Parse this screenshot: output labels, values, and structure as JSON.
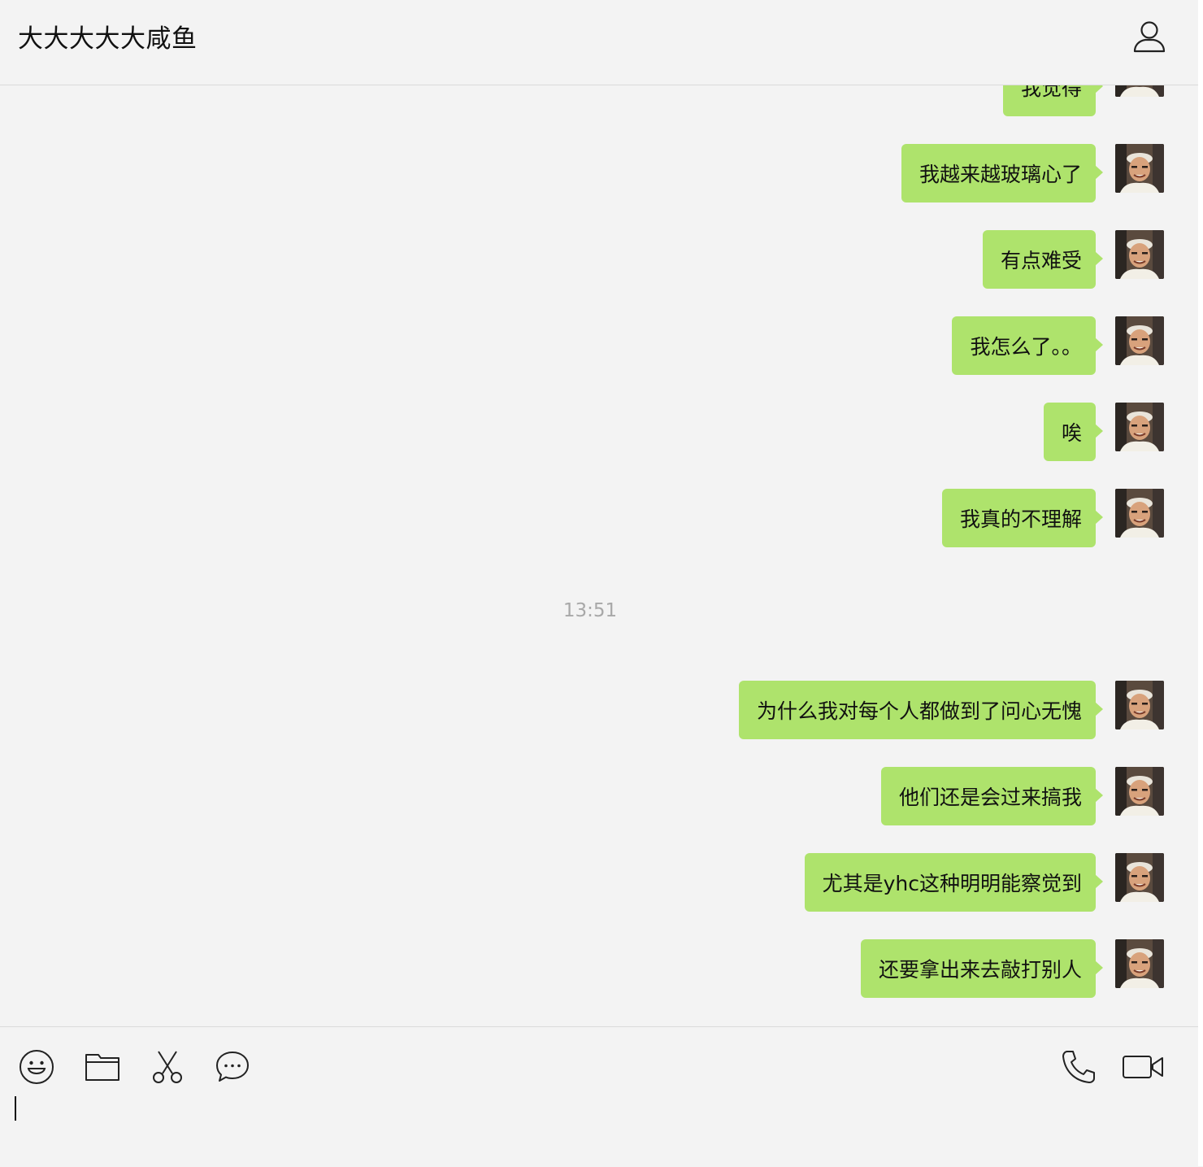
{
  "window": {
    "title": "大大大大大咸鱼"
  },
  "header": {
    "profile_icon": "person-icon"
  },
  "messages": [
    {
      "text": "我觉得",
      "sender": "me"
    },
    {
      "text": "我越来越玻璃心了",
      "sender": "me"
    },
    {
      "text": "有点难受",
      "sender": "me"
    },
    {
      "text": "我怎么了。。",
      "sender": "me"
    },
    {
      "text": "唉",
      "sender": "me"
    },
    {
      "text": "我真的不理解",
      "sender": "me"
    },
    {
      "timestamp": "13:51"
    },
    {
      "text": "为什么我对每个人都做到了问心无愧",
      "sender": "me"
    },
    {
      "text": "他们还是会过来搞我",
      "sender": "me"
    },
    {
      "text": "尤其是yhc这种明明能察觉到",
      "sender": "me"
    },
    {
      "text": "还要拿出来去敲打别人",
      "sender": "me"
    }
  ],
  "toolbar": {
    "left_tools": [
      "emoji-icon",
      "folder-icon",
      "scissors-icon",
      "chat-bubble-icon"
    ],
    "right_tools": [
      "phone-icon",
      "video-camera-icon"
    ]
  },
  "composer": {
    "value": ""
  },
  "colors": {
    "background": "#f3f3f3",
    "bubble": "#aee36c",
    "timestamp": "#a8a8a8"
  }
}
